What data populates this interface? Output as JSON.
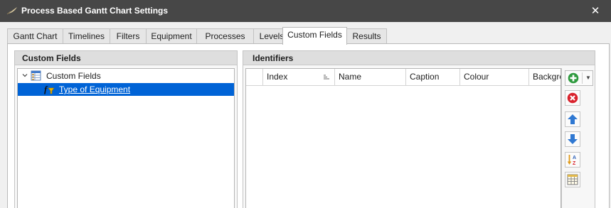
{
  "window": {
    "title": "Process Based Gantt Chart Settings",
    "close_glyph": "✕"
  },
  "tabs": [
    {
      "label": "Gantt Chart",
      "active": false
    },
    {
      "label": "Timelines",
      "active": false
    },
    {
      "label": "Filters",
      "active": false
    },
    {
      "label": "Equipment",
      "active": false
    },
    {
      "label": "Processes",
      "active": false
    },
    {
      "label": "Levels",
      "active": false
    },
    {
      "label": "Custom Fields",
      "active": true
    },
    {
      "label": "Results",
      "active": false
    }
  ],
  "left_panel": {
    "title": "Custom Fields",
    "tree": {
      "root": {
        "label": "Custom Fields",
        "icon": "table-icon",
        "expanded": true
      },
      "children": [
        {
          "label": "Type of Equipment",
          "icon": "function-icon",
          "selected": true
        }
      ]
    }
  },
  "right_panel": {
    "title": "Identifiers",
    "columns": [
      "",
      "Index",
      "Name",
      "Caption",
      "Colour",
      "Backgro"
    ],
    "rows": [],
    "toolbar": [
      "add-icon",
      "dropdown-arrow-icon",
      "delete-icon",
      "move-up-icon",
      "move-down-icon",
      "sort-az-icon",
      "grid-settings-icon"
    ]
  },
  "colors": {
    "titlebar": "#474747",
    "selection": "#0063d6",
    "panel_header": "#dedede"
  }
}
